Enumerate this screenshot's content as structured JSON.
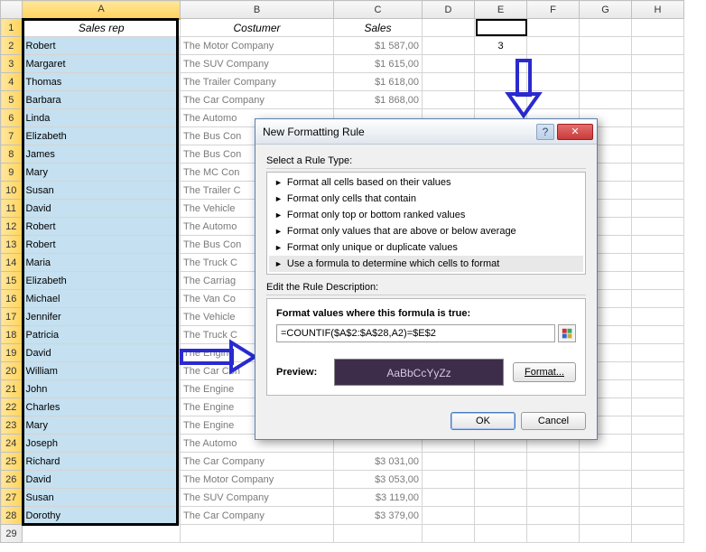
{
  "columns": [
    "A",
    "B",
    "C",
    "D",
    "E",
    "F",
    "G",
    "H"
  ],
  "headers": {
    "A": "Sales rep",
    "B": "Costumer",
    "C": "Sales"
  },
  "e2": "3",
  "rows": [
    {
      "n": 2,
      "a": "Robert",
      "b": "The Motor Company",
      "c": "$1 587,00"
    },
    {
      "n": 3,
      "a": "Margaret",
      "b": "The SUV Company",
      "c": "$1 615,00"
    },
    {
      "n": 4,
      "a": "Thomas",
      "b": "The Trailer Company",
      "c": "$1 618,00"
    },
    {
      "n": 5,
      "a": "Barbara",
      "b": "The Car Company",
      "c": "$1 868,00"
    },
    {
      "n": 6,
      "a": "Linda",
      "b": "The Automo",
      "c": ""
    },
    {
      "n": 7,
      "a": "Elizabeth",
      "b": "The Bus Con",
      "c": ""
    },
    {
      "n": 8,
      "a": "James",
      "b": "The Bus Con",
      "c": ""
    },
    {
      "n": 9,
      "a": "Mary",
      "b": "The MC Con",
      "c": ""
    },
    {
      "n": 10,
      "a": "Susan",
      "b": "The Trailer C",
      "c": ""
    },
    {
      "n": 11,
      "a": "David",
      "b": "The Vehicle",
      "c": ""
    },
    {
      "n": 12,
      "a": "Robert",
      "b": "The Automo",
      "c": ""
    },
    {
      "n": 13,
      "a": "Robert",
      "b": "The Bus Con",
      "c": ""
    },
    {
      "n": 14,
      "a": "Maria",
      "b": "The Truck C",
      "c": ""
    },
    {
      "n": 15,
      "a": "Elizabeth",
      "b": "The Carriag",
      "c": ""
    },
    {
      "n": 16,
      "a": "Michael",
      "b": "The Van Co",
      "c": ""
    },
    {
      "n": 17,
      "a": "Jennifer",
      "b": "The Vehicle",
      "c": ""
    },
    {
      "n": 18,
      "a": "Patricia",
      "b": "The Truck C",
      "c": ""
    },
    {
      "n": 19,
      "a": "David",
      "b": "The Engine",
      "c": ""
    },
    {
      "n": 20,
      "a": "William",
      "b": "The Car Con",
      "c": ""
    },
    {
      "n": 21,
      "a": "John",
      "b": "The Engine",
      "c": ""
    },
    {
      "n": 22,
      "a": "Charles",
      "b": "The Engine",
      "c": ""
    },
    {
      "n": 23,
      "a": "Mary",
      "b": "The Engine",
      "c": ""
    },
    {
      "n": 24,
      "a": "Joseph",
      "b": "The Automo",
      "c": ""
    },
    {
      "n": 25,
      "a": "Richard",
      "b": "The Car Company",
      "c": "$3 031,00"
    },
    {
      "n": 26,
      "a": "David",
      "b": "The Motor Company",
      "c": "$3 053,00"
    },
    {
      "n": 27,
      "a": "Susan",
      "b": "The SUV Company",
      "c": "$3 119,00"
    },
    {
      "n": 28,
      "a": "Dorothy",
      "b": "The Car Company",
      "c": "$3 379,00"
    }
  ],
  "dialog": {
    "title": "New Formatting Rule",
    "select_label": "Select a Rule Type:",
    "rules": [
      "Format all cells based on their values",
      "Format only cells that contain",
      "Format only top or bottom ranked values",
      "Format only values that are above or below average",
      "Format only unique or duplicate values",
      "Use a formula to determine which cells to format"
    ],
    "edit_label": "Edit the Rule Description:",
    "formula_label": "Format values where this formula is true:",
    "formula_value": "=COUNTIF($A$2:$A$28,A2)=$E$2",
    "preview_label": "Preview:",
    "preview_text": "AaBbCcYyZz",
    "format_btn": "Format...",
    "ok": "OK",
    "cancel": "Cancel"
  }
}
